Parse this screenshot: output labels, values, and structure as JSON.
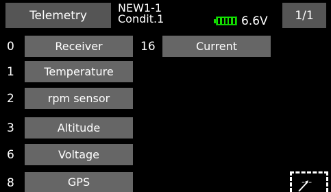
{
  "header": {
    "title": "Telemetry",
    "model": "NEW1-1",
    "condition": "Condit.1",
    "voltage": "6.6V",
    "page": "1/1",
    "battery_color": "#16e000"
  },
  "left_items": [
    {
      "num": "0",
      "label": "Receiver"
    },
    {
      "num": "1",
      "label": "Temperature"
    },
    {
      "num": "2",
      "label": "rpm sensor"
    },
    {
      "num": "3",
      "label": "Altitude"
    },
    {
      "num": "6",
      "label": "Voltage"
    },
    {
      "num": "8",
      "label": "GPS"
    }
  ],
  "right_items": [
    {
      "num": "16",
      "label": "Current"
    }
  ],
  "empty_slot": {
    "label": "---"
  }
}
